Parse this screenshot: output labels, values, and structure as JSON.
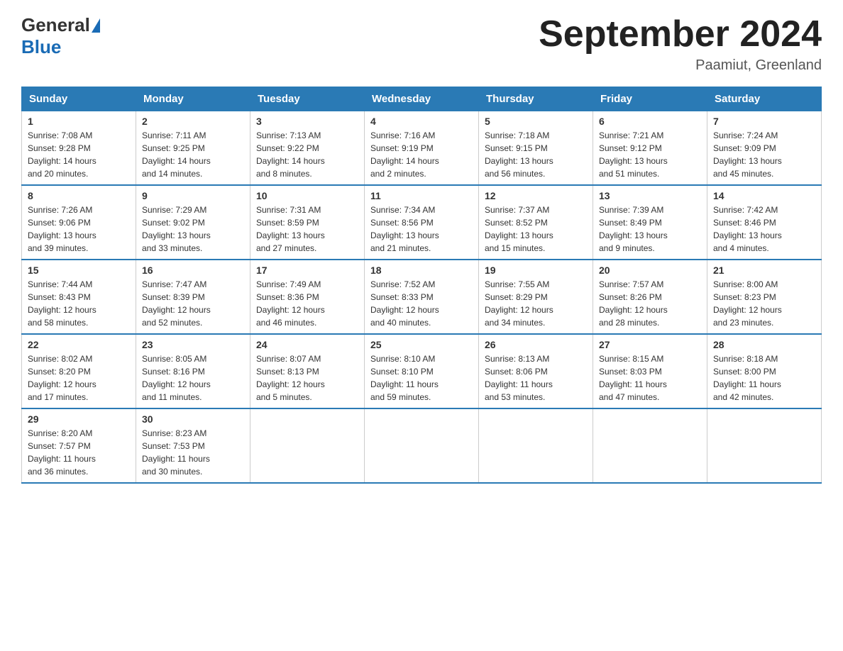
{
  "logo": {
    "general": "General",
    "blue": "Blue"
  },
  "title": "September 2024",
  "location": "Paamiut, Greenland",
  "headers": [
    "Sunday",
    "Monday",
    "Tuesday",
    "Wednesday",
    "Thursday",
    "Friday",
    "Saturday"
  ],
  "weeks": [
    [
      {
        "day": "1",
        "sunrise": "7:08 AM",
        "sunset": "9:28 PM",
        "daylight": "14 hours and 20 minutes."
      },
      {
        "day": "2",
        "sunrise": "7:11 AM",
        "sunset": "9:25 PM",
        "daylight": "14 hours and 14 minutes."
      },
      {
        "day": "3",
        "sunrise": "7:13 AM",
        "sunset": "9:22 PM",
        "daylight": "14 hours and 8 minutes."
      },
      {
        "day": "4",
        "sunrise": "7:16 AM",
        "sunset": "9:19 PM",
        "daylight": "14 hours and 2 minutes."
      },
      {
        "day": "5",
        "sunrise": "7:18 AM",
        "sunset": "9:15 PM",
        "daylight": "13 hours and 56 minutes."
      },
      {
        "day": "6",
        "sunrise": "7:21 AM",
        "sunset": "9:12 PM",
        "daylight": "13 hours and 51 minutes."
      },
      {
        "day": "7",
        "sunrise": "7:24 AM",
        "sunset": "9:09 PM",
        "daylight": "13 hours and 45 minutes."
      }
    ],
    [
      {
        "day": "8",
        "sunrise": "7:26 AM",
        "sunset": "9:06 PM",
        "daylight": "13 hours and 39 minutes."
      },
      {
        "day": "9",
        "sunrise": "7:29 AM",
        "sunset": "9:02 PM",
        "daylight": "13 hours and 33 minutes."
      },
      {
        "day": "10",
        "sunrise": "7:31 AM",
        "sunset": "8:59 PM",
        "daylight": "13 hours and 27 minutes."
      },
      {
        "day": "11",
        "sunrise": "7:34 AM",
        "sunset": "8:56 PM",
        "daylight": "13 hours and 21 minutes."
      },
      {
        "day": "12",
        "sunrise": "7:37 AM",
        "sunset": "8:52 PM",
        "daylight": "13 hours and 15 minutes."
      },
      {
        "day": "13",
        "sunrise": "7:39 AM",
        "sunset": "8:49 PM",
        "daylight": "13 hours and 9 minutes."
      },
      {
        "day": "14",
        "sunrise": "7:42 AM",
        "sunset": "8:46 PM",
        "daylight": "13 hours and 4 minutes."
      }
    ],
    [
      {
        "day": "15",
        "sunrise": "7:44 AM",
        "sunset": "8:43 PM",
        "daylight": "12 hours and 58 minutes."
      },
      {
        "day": "16",
        "sunrise": "7:47 AM",
        "sunset": "8:39 PM",
        "daylight": "12 hours and 52 minutes."
      },
      {
        "day": "17",
        "sunrise": "7:49 AM",
        "sunset": "8:36 PM",
        "daylight": "12 hours and 46 minutes."
      },
      {
        "day": "18",
        "sunrise": "7:52 AM",
        "sunset": "8:33 PM",
        "daylight": "12 hours and 40 minutes."
      },
      {
        "day": "19",
        "sunrise": "7:55 AM",
        "sunset": "8:29 PM",
        "daylight": "12 hours and 34 minutes."
      },
      {
        "day": "20",
        "sunrise": "7:57 AM",
        "sunset": "8:26 PM",
        "daylight": "12 hours and 28 minutes."
      },
      {
        "day": "21",
        "sunrise": "8:00 AM",
        "sunset": "8:23 PM",
        "daylight": "12 hours and 23 minutes."
      }
    ],
    [
      {
        "day": "22",
        "sunrise": "8:02 AM",
        "sunset": "8:20 PM",
        "daylight": "12 hours and 17 minutes."
      },
      {
        "day": "23",
        "sunrise": "8:05 AM",
        "sunset": "8:16 PM",
        "daylight": "12 hours and 11 minutes."
      },
      {
        "day": "24",
        "sunrise": "8:07 AM",
        "sunset": "8:13 PM",
        "daylight": "12 hours and 5 minutes."
      },
      {
        "day": "25",
        "sunrise": "8:10 AM",
        "sunset": "8:10 PM",
        "daylight": "11 hours and 59 minutes."
      },
      {
        "day": "26",
        "sunrise": "8:13 AM",
        "sunset": "8:06 PM",
        "daylight": "11 hours and 53 minutes."
      },
      {
        "day": "27",
        "sunrise": "8:15 AM",
        "sunset": "8:03 PM",
        "daylight": "11 hours and 47 minutes."
      },
      {
        "day": "28",
        "sunrise": "8:18 AM",
        "sunset": "8:00 PM",
        "daylight": "11 hours and 42 minutes."
      }
    ],
    [
      {
        "day": "29",
        "sunrise": "8:20 AM",
        "sunset": "7:57 PM",
        "daylight": "11 hours and 36 minutes."
      },
      {
        "day": "30",
        "sunrise": "8:23 AM",
        "sunset": "7:53 PM",
        "daylight": "11 hours and 30 minutes."
      },
      null,
      null,
      null,
      null,
      null
    ]
  ],
  "labels": {
    "sunrise": "Sunrise:",
    "sunset": "Sunset:",
    "daylight": "Daylight:"
  }
}
